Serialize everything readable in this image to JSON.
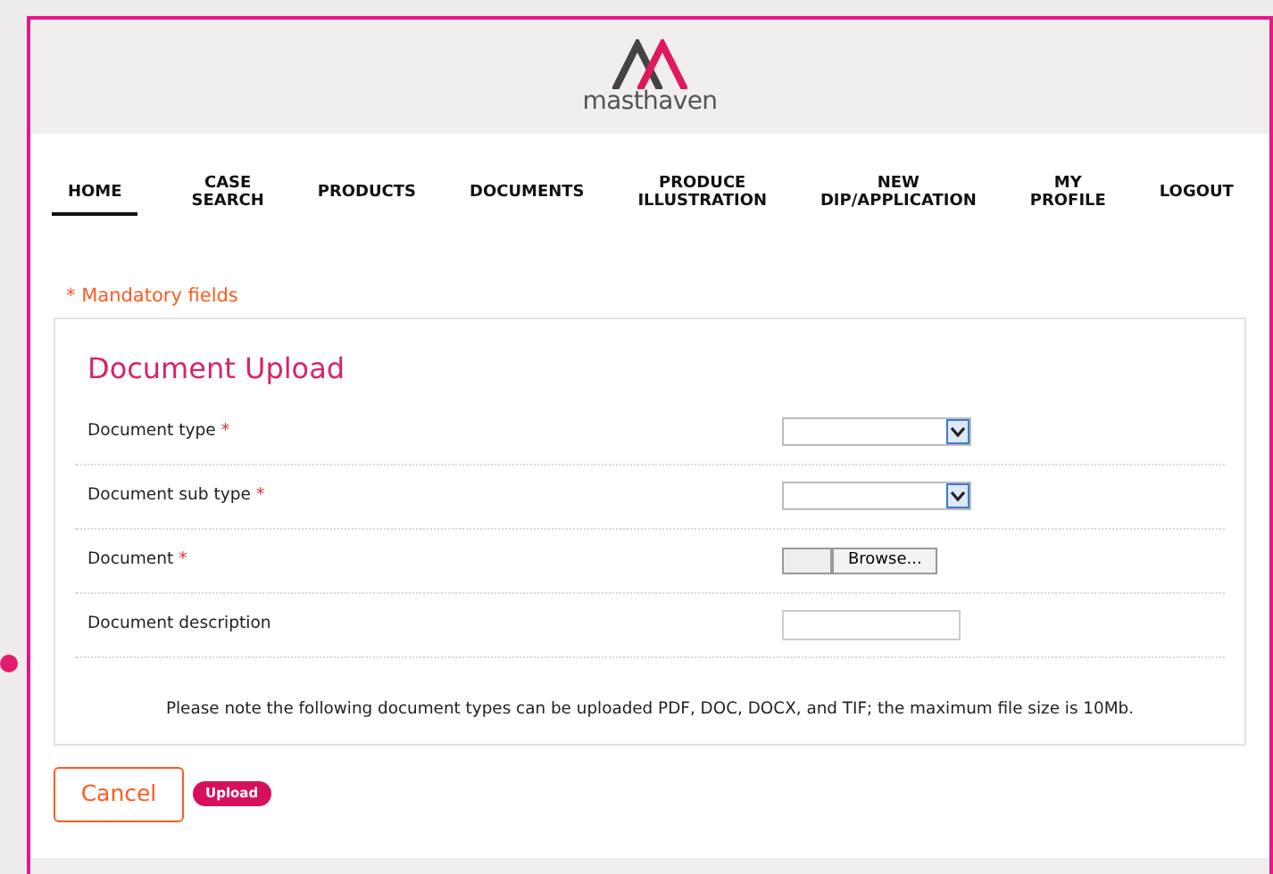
{
  "brand": {
    "name": "masthaven"
  },
  "nav": [
    {
      "label": "HOME",
      "selected": true
    },
    {
      "label": "CASE SEARCH",
      "selected": false
    },
    {
      "label": "PRODUCTS",
      "selected": false
    },
    {
      "label": "DOCUMENTS",
      "selected": false
    },
    {
      "label": "PRODUCE ILLUSTRATION",
      "selected": false
    },
    {
      "label": "NEW DIP/APPLICATION",
      "selected": false
    },
    {
      "label": "MY PROFILE",
      "selected": false
    },
    {
      "label": "LOGOUT",
      "selected": false
    }
  ],
  "mandatory_note": "* Mandatory fields",
  "form": {
    "title": "Document Upload",
    "fields": [
      {
        "label": "Document type",
        "required_mark": "*",
        "kind": "select"
      },
      {
        "label": "Document sub type",
        "required_mark": "*",
        "kind": "select"
      },
      {
        "label": "Document",
        "required_mark": "*",
        "kind": "file",
        "button": "Browse..."
      },
      {
        "label": "Document description",
        "kind": "text"
      }
    ],
    "note": "Please note the following document types can be uploaded PDF, DOC, DOCX, and TIF; the maximum file size is 10Mb."
  },
  "buttons": {
    "cancel": "Cancel",
    "upload": "Upload"
  }
}
